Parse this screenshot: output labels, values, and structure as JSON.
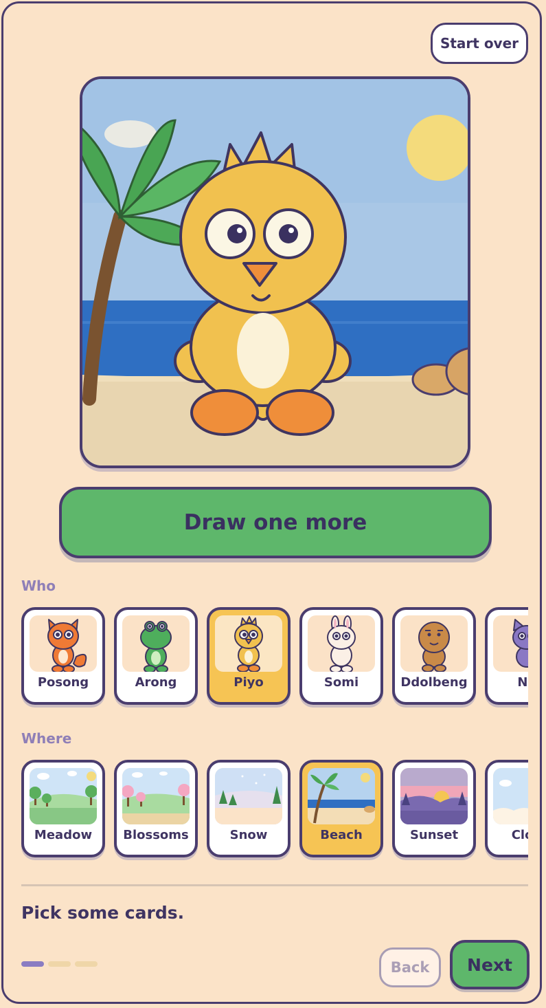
{
  "header": {
    "start_over_label": "Start over"
  },
  "scene": {
    "character": "Piyo",
    "setting": "Beach"
  },
  "draw_more_label": "Draw one more",
  "who": {
    "label": "Who",
    "cards": [
      {
        "name": "Posong",
        "icon": "fox-icon",
        "selected": false
      },
      {
        "name": "Arong",
        "icon": "frog-icon",
        "selected": false
      },
      {
        "name": "Piyo",
        "icon": "chick-icon",
        "selected": true
      },
      {
        "name": "Somi",
        "icon": "bunny-icon",
        "selected": false
      },
      {
        "name": "Ddolbeng",
        "icon": "bear-icon",
        "selected": false
      },
      {
        "name": "Na",
        "icon": "cat-icon",
        "selected": false
      }
    ]
  },
  "where": {
    "label": "Where",
    "cards": [
      {
        "name": "Meadow",
        "icon": "meadow-icon",
        "selected": false
      },
      {
        "name": "Blossoms",
        "icon": "blossoms-icon",
        "selected": false
      },
      {
        "name": "Snow",
        "icon": "snow-icon",
        "selected": false
      },
      {
        "name": "Beach",
        "icon": "beach-icon",
        "selected": true
      },
      {
        "name": "Sunset",
        "icon": "sunset-icon",
        "selected": false
      },
      {
        "name": "Clou",
        "icon": "clouds-icon",
        "selected": false
      }
    ]
  },
  "footer": {
    "hint": "Pick some cards.",
    "step": 1,
    "steps_total": 3,
    "back_label": "Back",
    "next_label": "Next"
  },
  "colors": {
    "background": "#fbe3c8",
    "outline": "#4a3d6e",
    "accent_green": "#5eb76b",
    "selected_yellow": "#f6c454",
    "section_label": "#8f7fb7"
  }
}
